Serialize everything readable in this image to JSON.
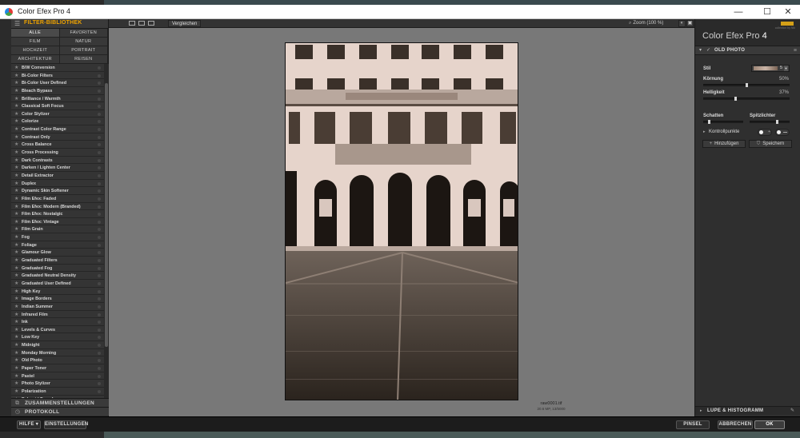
{
  "window": {
    "title": "Color Efex Pro 4",
    "minimize": "—",
    "maximize": "☐",
    "close": "✕"
  },
  "library": {
    "header": "FILTER-BIBLIOTHEK",
    "categories": [
      "ALLE",
      "FAVORITEN",
      "FILM",
      "NATUR",
      "HOCHZEIT",
      "PORTRAIT",
      "ARCHITEKTUR",
      "REISEN"
    ],
    "active_category": "ALLE",
    "filters": [
      "B/W Conversion",
      "Bi-Color Filters",
      "Bi-Color User Defined",
      "Bleach Bypass",
      "Brilliance / Warmth",
      "Classical Soft Focus",
      "Color Stylizer",
      "Colorize",
      "Contrast Color Range",
      "Contrast Only",
      "Cross Balance",
      "Cross Processing",
      "Dark Contrasts",
      "Darken / Lighten Center",
      "Detail Extractor",
      "Duplex",
      "Dynamic Skin Softener",
      "Film Efex: Faded",
      "Film Efex: Modern (Branded)",
      "Film Efex: Nostalgic",
      "Film Efex: Vintage",
      "Film Grain",
      "Fog",
      "Foliage",
      "Glamour Glow",
      "Graduated Filters",
      "Graduated Fog",
      "Graduated Neutral Density",
      "Graduated User Defined",
      "High Key",
      "Image Borders",
      "Indian Summer",
      "Infrared Film",
      "Ink",
      "Levels & Curves",
      "Low Key",
      "Midnight",
      "Monday Morning",
      "Old Photo",
      "Paper Toner",
      "Pastel",
      "Photo Stylizer",
      "Polarization",
      "Polaroid Transfer"
    ],
    "footer_presets": "ZUSAMMENSTELLUNGEN",
    "footer_history": "PROTOKOLL"
  },
  "toolbar": {
    "compare": "Vergleichen",
    "zoom": "Zoom (100 %)"
  },
  "preview": {
    "filename": "raw0001.tif",
    "info": "20.6 MP, 13/5000"
  },
  "panel": {
    "title": "Color Efex Pro",
    "version": "4",
    "brand_small": "collection by Nik",
    "filter_name": "OLD PHOTO",
    "stil_label": "Stil",
    "stil_value": "5",
    "koernung_label": "Körnung",
    "koernung_value": "50%",
    "koernung_level": 0.5,
    "helligkeit_label": "Helligkeit",
    "helligkeit_value": "37%",
    "helligkeit_level": 0.37,
    "schatten_label": "Schatten",
    "schatten_level": 0.12,
    "spitzlichter_label": "Spitzlichter",
    "spitzlichter_level": 0.7,
    "kontrollpunkte_label": "Kontrollpunkte",
    "hinzufuegen": "Hinzufügen",
    "speichern": "Speichern",
    "lupe": "LUPE & HISTOGRAMM"
  },
  "bottom": {
    "hilfe": "HILFE ▾",
    "einstellungen": "EINSTELLUNGEN",
    "pinsel": "PINSEL",
    "abbrechen": "ABBRECHEN",
    "ok": "OK"
  }
}
